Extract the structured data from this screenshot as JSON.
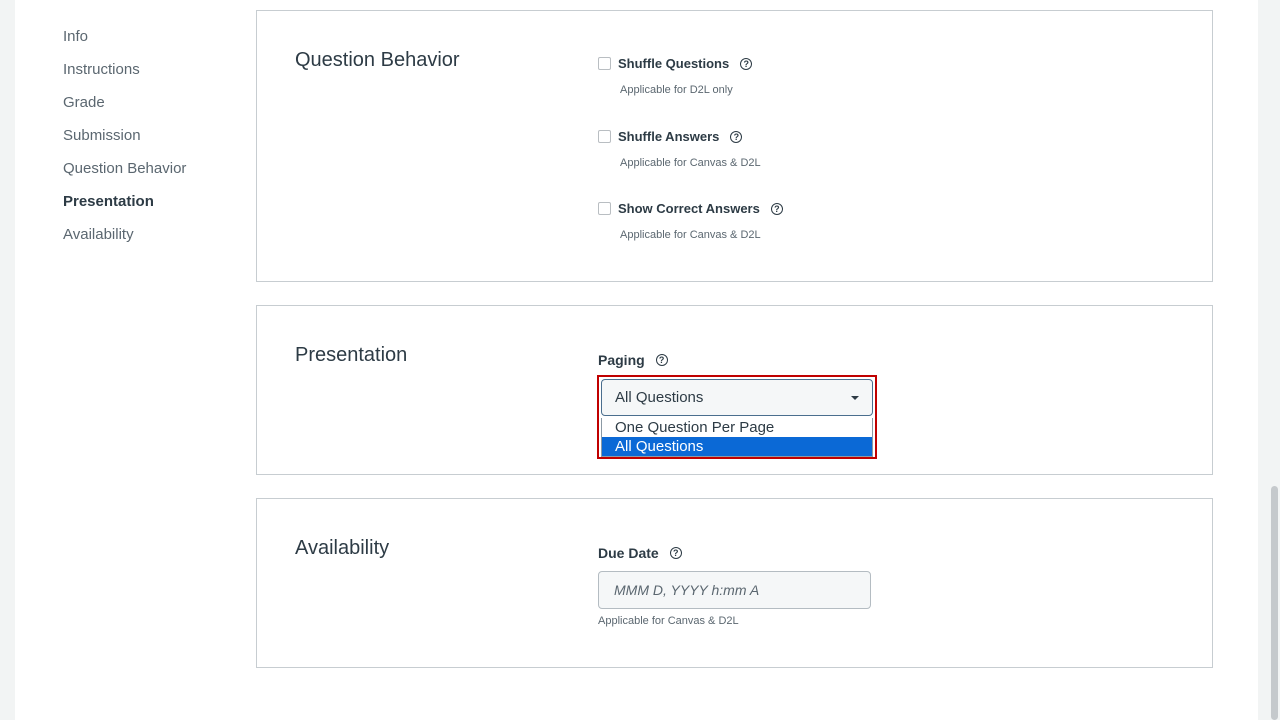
{
  "nav": {
    "items": [
      {
        "label": "Info"
      },
      {
        "label": "Instructions"
      },
      {
        "label": "Grade"
      },
      {
        "label": "Submission"
      },
      {
        "label": "Question Behavior"
      },
      {
        "label": "Presentation"
      },
      {
        "label": "Availability"
      }
    ],
    "active": "Presentation"
  },
  "question_behavior": {
    "title": "Question Behavior",
    "options": [
      {
        "label": "Shuffle Questions",
        "hint": "Applicable for D2L only",
        "checked": false
      },
      {
        "label": "Shuffle Answers",
        "hint": "Applicable for Canvas & D2L",
        "checked": false
      },
      {
        "label": "Show Correct Answers",
        "hint": "Applicable for Canvas & D2L",
        "checked": false
      }
    ]
  },
  "presentation": {
    "title": "Presentation",
    "paging_label": "Paging",
    "paging_value": "All Questions",
    "paging_options": [
      "One Question Per Page",
      "All Questions"
    ]
  },
  "availability": {
    "title": "Availability",
    "due_date_label": "Due Date",
    "due_date_placeholder": "MMM D, YYYY h:mm A",
    "due_date_hint": "Applicable for Canvas & D2L"
  },
  "colors": {
    "selected_option": "#0b69d6",
    "highlight_border": "#c00000"
  },
  "icons": {
    "help": "question-circle-icon",
    "caret": "caret-down-icon"
  }
}
